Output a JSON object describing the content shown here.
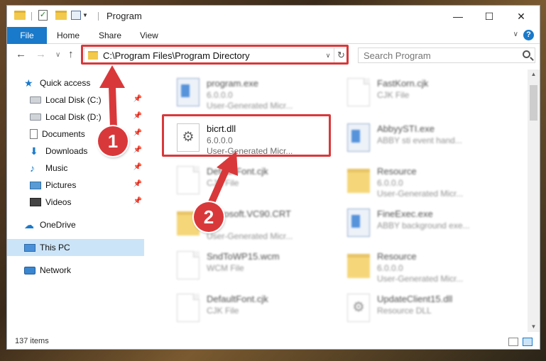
{
  "window": {
    "title": "Program",
    "minimize_glyph": "—",
    "maximize_glyph": "☐",
    "close_glyph": "✕"
  },
  "ribbon": {
    "tabs": [
      "File",
      "Home",
      "Share",
      "View"
    ],
    "help_glyph": "?"
  },
  "nav": {
    "back_glyph": "←",
    "forward_glyph": "→",
    "recent_glyph": "∨",
    "up_glyph": "↑",
    "address": "C:\\Program Files\\Program Directory",
    "search_placeholder": "Search Program"
  },
  "sidebar": {
    "items": [
      {
        "label": "Quick access",
        "icon": "star-icon",
        "pinned": false
      },
      {
        "label": "Local Disk (C:)",
        "icon": "drive-icon",
        "pinned": true
      },
      {
        "label": "Local Disk (D:)",
        "icon": "drive-icon",
        "pinned": true
      },
      {
        "label": "Documents",
        "icon": "document-icon",
        "pinned": true
      },
      {
        "label": "Downloads",
        "icon": "download-icon",
        "pinned": true
      },
      {
        "label": "Music",
        "icon": "music-icon",
        "pinned": true
      },
      {
        "label": "Pictures",
        "icon": "pictures-icon",
        "pinned": true
      },
      {
        "label": "Videos",
        "icon": "video-icon",
        "pinned": true
      },
      {
        "label": "OneDrive",
        "icon": "cloud-icon",
        "pinned": false
      },
      {
        "label": "This PC",
        "icon": "computer-icon",
        "pinned": false,
        "selected": true
      },
      {
        "label": "Network",
        "icon": "network-icon",
        "pinned": false
      }
    ]
  },
  "files": [
    {
      "name": "program.exe",
      "line1": "6.0.0.0",
      "line2": "User-Generated Micr...",
      "icon": "exe-icon"
    },
    {
      "name": "FastKorn.cjk",
      "line1": "CJK File",
      "line2": "",
      "icon": "file-icon"
    },
    {
      "name": "bicrt.dll",
      "line1": "6.0.0.0",
      "line2": "User-Generated Micr...",
      "icon": "gear-file-icon",
      "selected": true
    },
    {
      "name": "AbbyySTI.exe",
      "line1": "ABBY sti event hand...",
      "line2": "",
      "icon": "exe-icon"
    },
    {
      "name": "DefaultFont.cjk",
      "line1": "CJK File",
      "line2": "",
      "icon": "file-icon"
    },
    {
      "name": "Resource",
      "line1": "6.0.0.0",
      "line2": "User-Generated Micr...",
      "icon": "folder-icon"
    },
    {
      "name": "Microsoft.VC90.CRT",
      "line1": "",
      "line2": "User-Generated Micr...",
      "icon": "folder-icon"
    },
    {
      "name": "FineExec.exe",
      "line1": "ABBY background exe...",
      "line2": "",
      "icon": "exe-icon"
    },
    {
      "name": "SndToWP15.wcm",
      "line1": "WCM File",
      "line2": "",
      "icon": "file-icon"
    },
    {
      "name": "Resource",
      "line1": "6.0.0.0",
      "line2": "User-Generated Micr...",
      "icon": "folder-icon"
    },
    {
      "name": "DefaultFont.cjk",
      "line1": "CJK File",
      "line2": "",
      "icon": "file-icon"
    },
    {
      "name": "UpdateClient15.dll",
      "line1": "Resource DLL",
      "line2": "",
      "icon": "gear-file-icon"
    }
  ],
  "status": {
    "item_count": "137 items"
  },
  "annotations": {
    "step1": "1",
    "step2": "2",
    "color": "#d9383a"
  }
}
